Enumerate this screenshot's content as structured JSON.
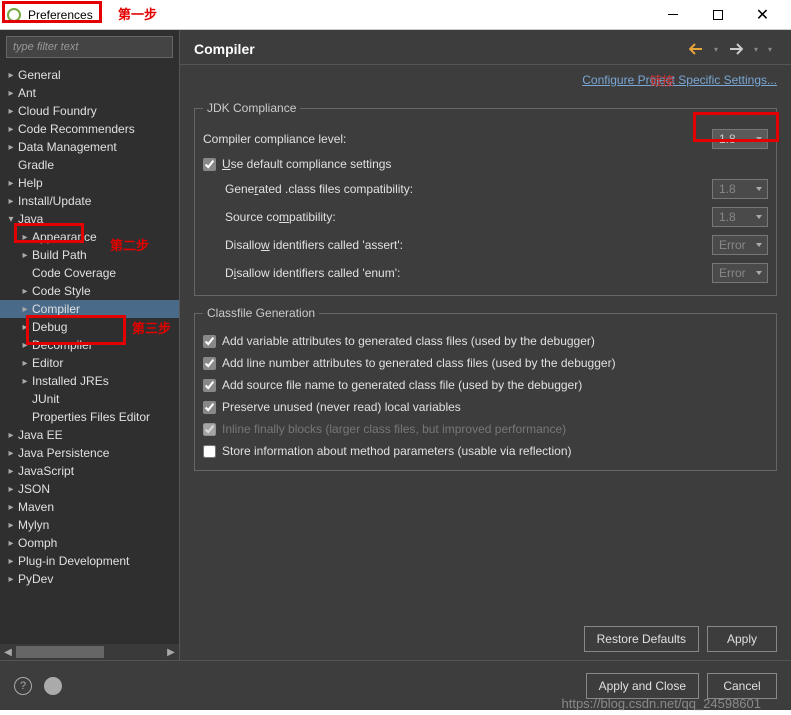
{
  "window": {
    "title": "Preferences"
  },
  "annotations": {
    "step1": "第一步",
    "step2": "第二步",
    "step3": "第三步",
    "link_overlap": "链接",
    "watermark": "https://blog.csdn.net/qq_24598601"
  },
  "sidebar": {
    "filter_placeholder": "type filter text",
    "items": [
      {
        "label": "General",
        "level": 1,
        "expandable": true
      },
      {
        "label": "Ant",
        "level": 1,
        "expandable": true
      },
      {
        "label": "Cloud Foundry",
        "level": 1,
        "expandable": true
      },
      {
        "label": "Code Recommenders",
        "level": 1,
        "expandable": true
      },
      {
        "label": "Data Management",
        "level": 1,
        "expandable": true
      },
      {
        "label": "Gradle",
        "level": 1,
        "expandable": false
      },
      {
        "label": "Help",
        "level": 1,
        "expandable": true
      },
      {
        "label": "Install/Update",
        "level": 1,
        "expandable": true
      },
      {
        "label": "Java",
        "level": 1,
        "expandable": true,
        "expanded": true
      },
      {
        "label": "Appearance",
        "level": 2,
        "expandable": true
      },
      {
        "label": "Build Path",
        "level": 2,
        "expandable": true
      },
      {
        "label": "Code Coverage",
        "level": 2,
        "expandable": false
      },
      {
        "label": "Code Style",
        "level": 2,
        "expandable": true
      },
      {
        "label": "Compiler",
        "level": 2,
        "expandable": true,
        "selected": true
      },
      {
        "label": "Debug",
        "level": 2,
        "expandable": true
      },
      {
        "label": "Decompiler",
        "level": 2,
        "expandable": true
      },
      {
        "label": "Editor",
        "level": 2,
        "expandable": true
      },
      {
        "label": "Installed JREs",
        "level": 2,
        "expandable": true
      },
      {
        "label": "JUnit",
        "level": 2,
        "expandable": false
      },
      {
        "label": "Properties Files Editor",
        "level": 2,
        "expandable": false
      },
      {
        "label": "Java EE",
        "level": 1,
        "expandable": true
      },
      {
        "label": "Java Persistence",
        "level": 1,
        "expandable": true
      },
      {
        "label": "JavaScript",
        "level": 1,
        "expandable": true
      },
      {
        "label": "JSON",
        "level": 1,
        "expandable": true
      },
      {
        "label": "Maven",
        "level": 1,
        "expandable": true
      },
      {
        "label": "Mylyn",
        "level": 1,
        "expandable": true
      },
      {
        "label": "Oomph",
        "level": 1,
        "expandable": true
      },
      {
        "label": "Plug-in Development",
        "level": 1,
        "expandable": true
      },
      {
        "label": "PyDev",
        "level": 1,
        "expandable": true
      }
    ]
  },
  "main": {
    "title": "Compiler",
    "link": "Configure Project Specific Settings...",
    "jdk": {
      "legend": "JDK Compliance",
      "compliance_label": "Compiler compliance level:",
      "compliance_value": "1.8",
      "use_default_label": "Use default compliance settings",
      "use_default_checked": true,
      "gen_class_label": "Generated .class files compatibility:",
      "gen_class_value": "1.8",
      "source_label": "Source compatibility:",
      "source_value": "1.8",
      "assert_label": "Disallow identifiers called 'assert':",
      "assert_value": "Error",
      "enum_label": "Disallow identifiers called 'enum':",
      "enum_value": "Error"
    },
    "classfile": {
      "legend": "Classfile Generation",
      "opts": [
        {
          "label": "Add variable attributes to generated class files (used by the debugger)",
          "checked": true
        },
        {
          "label": "Add line number attributes to generated class files (used by the debugger)",
          "checked": true
        },
        {
          "label": "Add source file name to generated class file (used by the debugger)",
          "checked": true
        },
        {
          "label": "Preserve unused (never read) local variables",
          "checked": true
        },
        {
          "label": "Inline finally blocks (larger class files, but improved performance)",
          "checked": true,
          "disabled": true
        },
        {
          "label": "Store information about method parameters (usable via reflection)",
          "checked": false
        }
      ]
    },
    "buttons": {
      "restore": "Restore Defaults",
      "apply": "Apply",
      "apply_close": "Apply and Close",
      "cancel": "Cancel"
    }
  }
}
